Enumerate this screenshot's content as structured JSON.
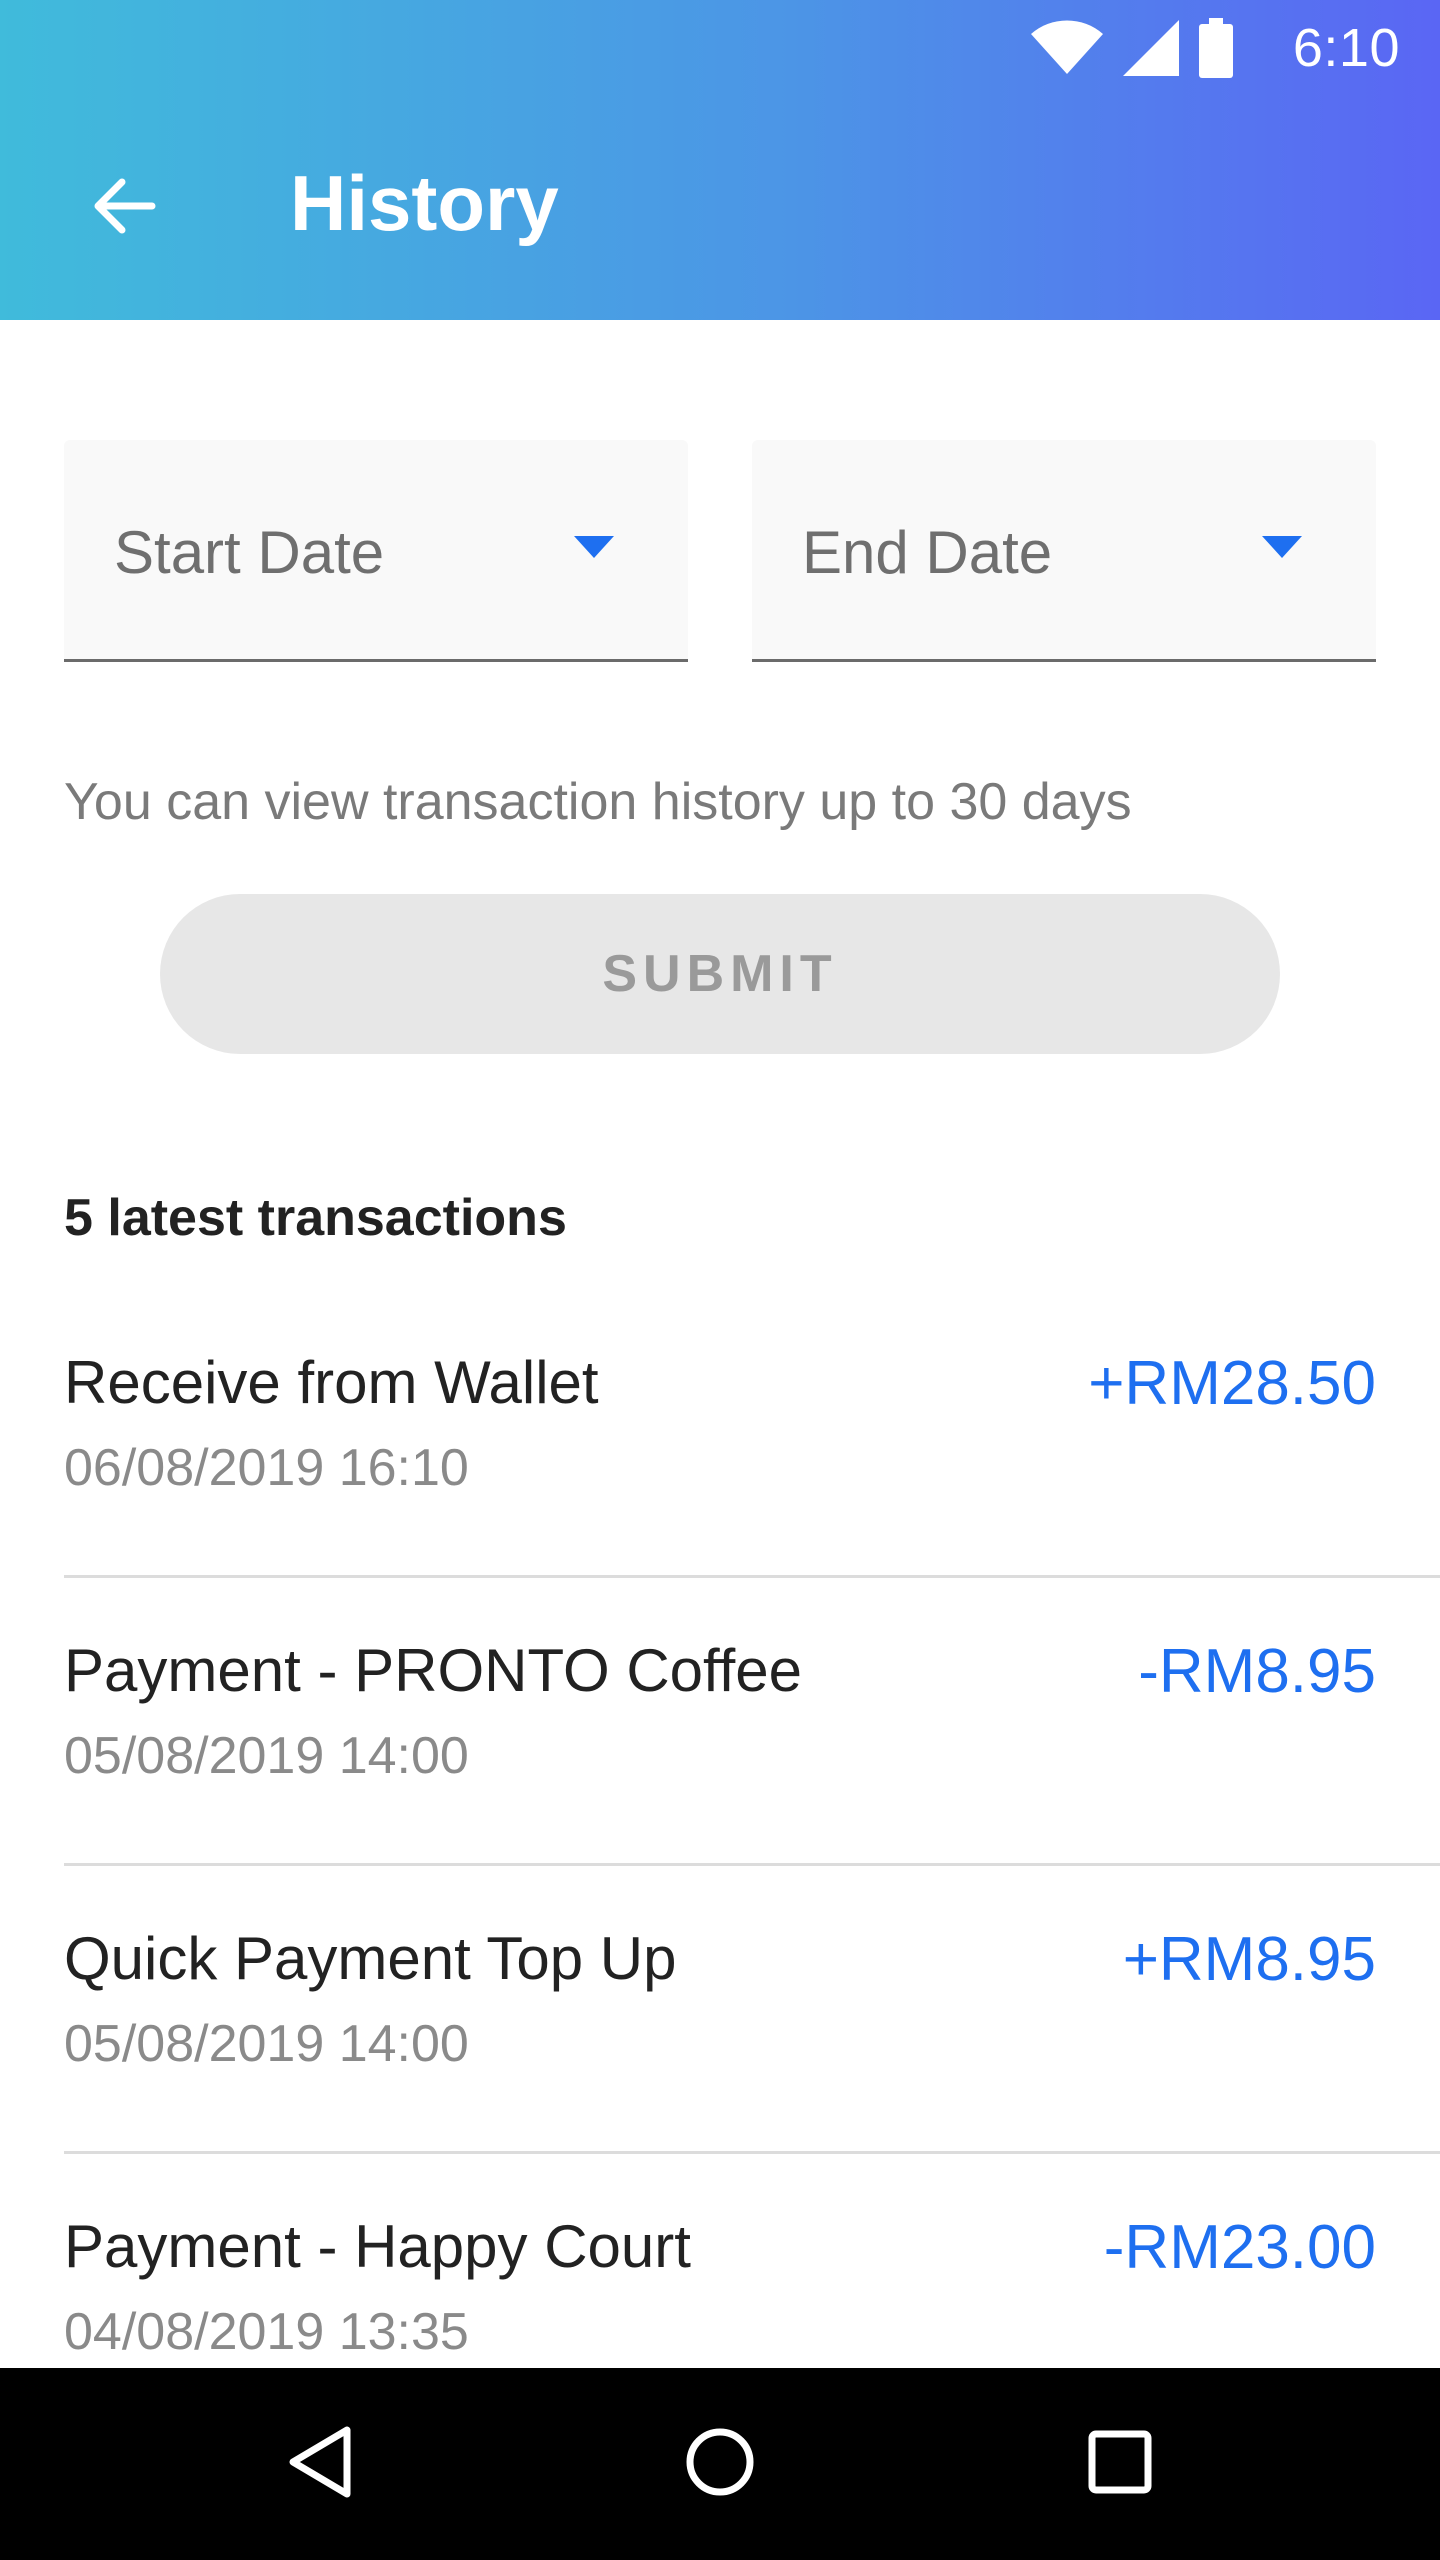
{
  "status_bar": {
    "time": "6:10"
  },
  "toolbar": {
    "title": "History"
  },
  "filters": {
    "start_date_label": "Start Date",
    "end_date_label": "End Date",
    "info": "You can view transaction history up to 30 days",
    "submit_label": "SUBMIT"
  },
  "transactions": {
    "section_title": "5 latest transactions",
    "items": [
      {
        "title": "Receive from Wallet",
        "date": "06/08/2019 16:10",
        "amount": "+RM28.50"
      },
      {
        "title": "Payment - PRONTO Coffee",
        "date": "05/08/2019 14:00",
        "amount": "-RM8.95"
      },
      {
        "title": "Quick Payment Top Up",
        "date": "05/08/2019 14:00",
        "amount": "+RM8.95"
      },
      {
        "title": "Payment - Happy Court",
        "date": "04/08/2019 13:35",
        "amount": "-RM23.00"
      }
    ]
  },
  "colors": {
    "header_gradient_start": "#40BBDB",
    "header_gradient_end": "#5A66F4",
    "accent": "#1E6FF0",
    "submit_disabled_bg": "#E7E7E7"
  },
  "icons": {
    "back": "arrow-left-icon",
    "wifi": "wifi-icon",
    "signal": "cell-signal-icon",
    "battery": "battery-icon",
    "dropdown": "caret-down-icon",
    "nav_back": "triangle-back-icon",
    "nav_home": "circle-home-icon",
    "nav_recent": "square-recents-icon"
  }
}
